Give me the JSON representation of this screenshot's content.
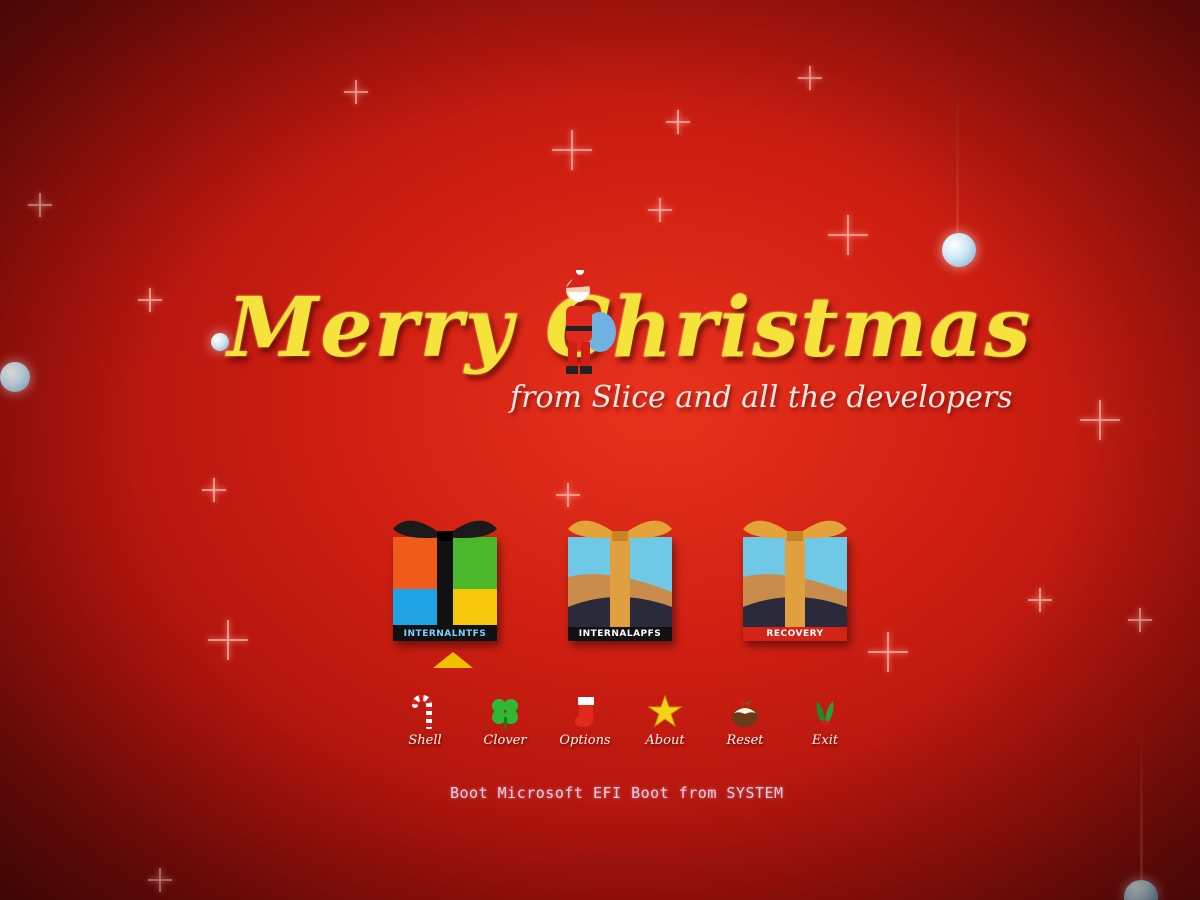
{
  "banner": {
    "title": "Merry Christmas",
    "subtitle": "from Slice and all the developers"
  },
  "boot_entries": [
    {
      "label": "INTERNALNTFS",
      "icon": "windows-gift-icon",
      "selected": true
    },
    {
      "label": "INTERNALAPFS",
      "icon": "macos-gift-icon",
      "selected": false
    },
    {
      "label": "RECOVERY",
      "icon": "recovery-gift-icon",
      "selected": false
    }
  ],
  "tools": [
    {
      "label": "Shell",
      "icon": "candy-cane-icon"
    },
    {
      "label": "Clover",
      "icon": "clover-icon"
    },
    {
      "label": "Options",
      "icon": "stocking-icon"
    },
    {
      "label": "About",
      "icon": "star-icon"
    },
    {
      "label": "Reset",
      "icon": "pudding-icon"
    },
    {
      "label": "Exit",
      "icon": "holly-icon"
    }
  ],
  "status": "Boot Microsoft EFI Boot from SYSTEM",
  "colors": {
    "background": "#cf1f12",
    "title": "#f5e23a",
    "selector": "#f2c000"
  }
}
